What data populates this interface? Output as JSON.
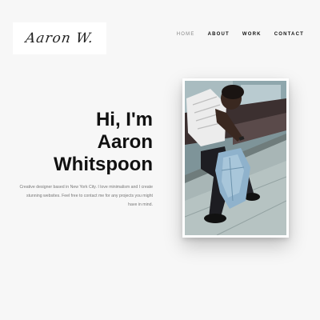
{
  "logo": {
    "text": "Aaron W."
  },
  "nav": {
    "items": [
      {
        "label": "HOME"
      },
      {
        "label": "ABOUT"
      },
      {
        "label": "WORK"
      },
      {
        "label": "CONTACT"
      }
    ],
    "active_index": 0
  },
  "hero": {
    "title_line1": "Hi, I'm",
    "title_line2": "Aaron",
    "title_line3": "Whitspoon",
    "description": "Creative designer based in New York City. I love minimalism and I create stunning websites. Feel free to contact me for any projects you might have in mind."
  },
  "photo": {
    "icon": "portrait-photo"
  }
}
